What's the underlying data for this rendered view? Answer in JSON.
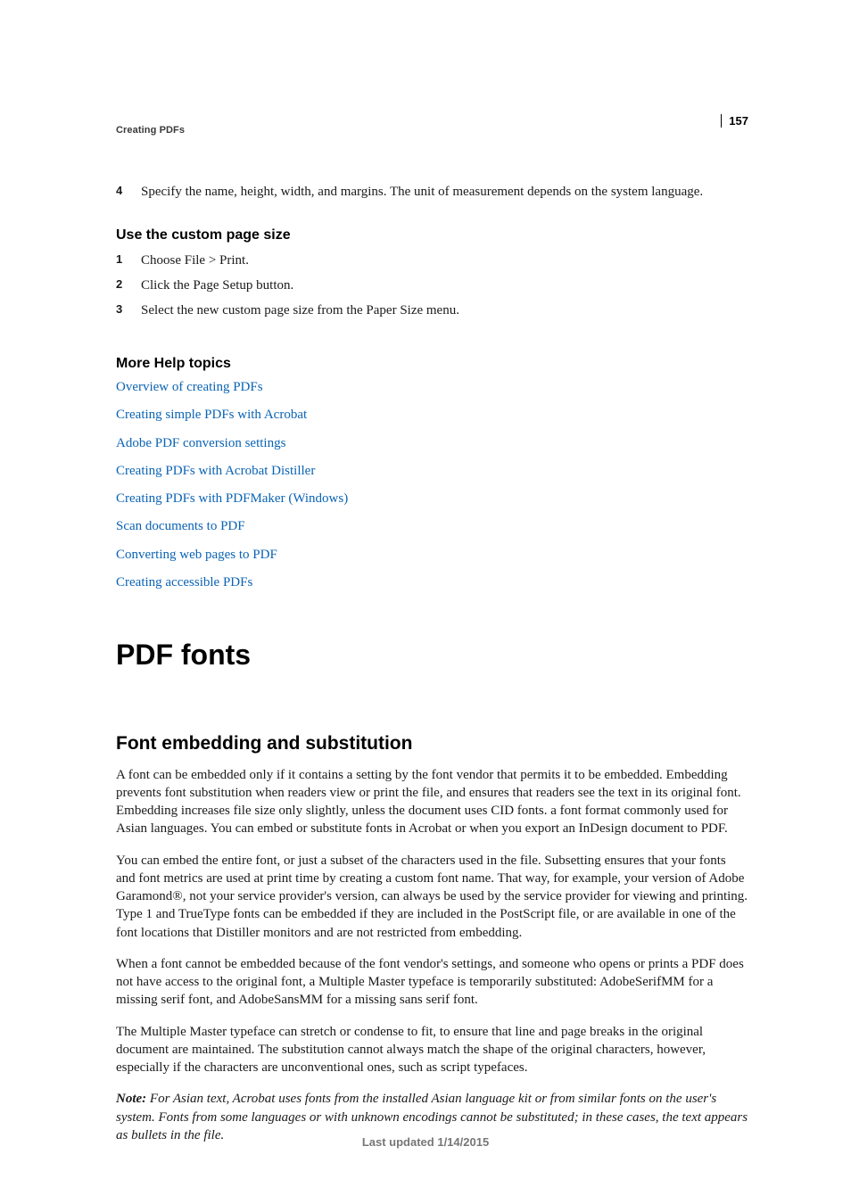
{
  "page_number": "157",
  "running_head": "Creating PDFs",
  "intro_step": {
    "num": "4",
    "text": "Specify the name, height, width, and margins. The unit of measurement depends on the system language."
  },
  "custom_size": {
    "heading": "Use the custom page size",
    "steps": [
      {
        "num": "1",
        "text": "Choose File > Print."
      },
      {
        "num": "2",
        "text": "Click the Page Setup button."
      },
      {
        "num": "3",
        "text": "Select the new custom page size from the Paper Size menu."
      }
    ]
  },
  "help": {
    "heading": "More Help topics",
    "links": [
      "Overview of creating PDFs",
      "Creating simple PDFs with Acrobat",
      "Adobe PDF conversion settings",
      "Creating PDFs with Acrobat Distiller",
      "Creating PDFs with PDFMaker (Windows)",
      "Scan documents to PDF",
      "Converting web pages to PDF",
      "Creating accessible PDFs"
    ]
  },
  "section_title": "PDF fonts",
  "subsection_title": "Font embedding and substitution",
  "paragraphs": [
    "A font can be embedded only if it contains a setting by the font vendor that permits it to be embedded. Embedding prevents font substitution when readers view or print the file, and ensures that readers see the text in its original font. Embedding increases file size only slightly, unless the document uses CID fonts. a font format commonly used for Asian languages. You can embed or substitute fonts in Acrobat or when you export an InDesign document to PDF.",
    "You can embed the entire font, or just a subset of the characters used in the file. Subsetting ensures that your fonts and font metrics are used at print time by creating a custom font name. That way, for example, your version of Adobe Garamond®, not your service provider's version, can always be used by the service provider for viewing and printing. Type 1 and TrueType fonts can be embedded if they are included in the PostScript file, or are available in one of the font locations that Distiller monitors and are not restricted from embedding.",
    "When a font cannot be embedded because of the font vendor's settings, and someone who opens or prints a PDF does not have access to the original font, a Multiple Master typeface is temporarily substituted: AdobeSerifMM for a missing serif font, and AdobeSansMM for a missing sans serif font.",
    "The Multiple Master typeface can stretch or condense to fit, to ensure that line and page breaks in the original document are maintained. The substitution cannot always match the shape of the original characters, however, especially if the characters are unconventional ones, such as script typefaces."
  ],
  "note": {
    "label": "Note:",
    "text": " For Asian text, Acrobat uses fonts from the installed Asian language kit or from similar fonts on the user's system. Fonts from some languages or with unknown encodings cannot be substituted; in these cases, the text appears as bullets in the file."
  },
  "footer": "Last updated 1/14/2015"
}
